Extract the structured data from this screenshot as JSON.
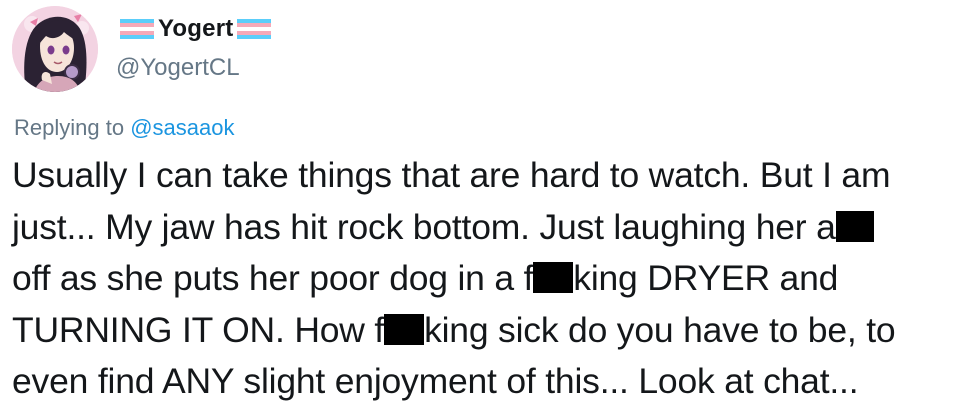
{
  "user": {
    "display_name": "Yogert",
    "handle": "@YogertCL",
    "avatar_icon": "anime-avatar-icon",
    "flag_icon": "trans-flag-icon",
    "flag_colors": [
      "#5bcefa",
      "#f5a9b8",
      "#ffffff",
      "#f5a9b8",
      "#5bcefa"
    ]
  },
  "reply": {
    "prefix": "Replying to",
    "mention": "@sasaaok"
  },
  "tweet": {
    "line1": "Usually I can take things that are hard to watch. But I am",
    "line2_a": "just... My jaw has hit rock bottom. Just laughing her a",
    "line3_a": "off as she puts her poor dog in a f",
    "line3_b": "king DRYER and",
    "line4_a": "TURNING IT ON. How f",
    "line4_b": "king sick do you have to be, to",
    "line5": "even find ANY slight enjoyment of this... Look at chat..."
  },
  "colors": {
    "text": "#14171a",
    "secondary": "#657786",
    "link": "#1b95e0",
    "censor": "#000000"
  }
}
